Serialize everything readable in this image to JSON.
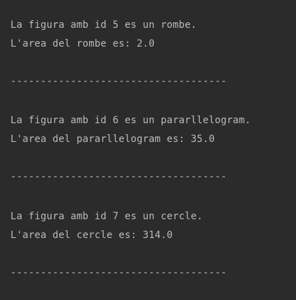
{
  "console": {
    "colors": {
      "background": "#2b2b2b",
      "text": "#bbbbbb"
    },
    "lines": [
      "La figura amb id 5 es un rombe.",
      "L'area del rombe es: 2.0",
      "------------------------------------",
      "La figura amb id 6 es un pararllelogram.",
      "L'area del pararllelogram es: 35.0",
      "------------------------------------",
      "La figura amb id 7 es un cercle.",
      "L'area del cercle es: 314.0",
      "------------------------------------"
    ]
  }
}
